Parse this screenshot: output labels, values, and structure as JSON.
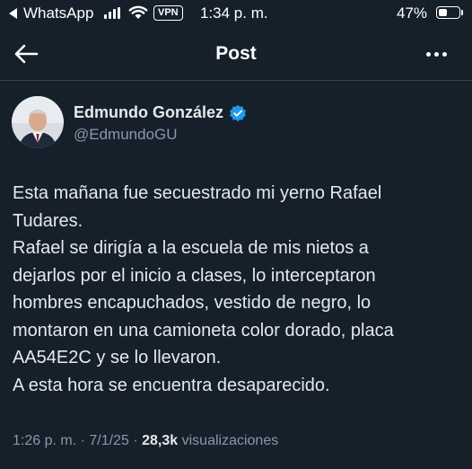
{
  "status_bar": {
    "back_app": "WhatsApp",
    "vpn": "VPN",
    "time": "1:34 p. m.",
    "battery": "47%",
    "battery_level": 0.47
  },
  "header": {
    "title": "Post",
    "back_icon": "arrow-left-icon",
    "more_icon": "ellipsis-horizontal-icon"
  },
  "author": {
    "name": "Edmundo González",
    "handle": "@EdmundoGU",
    "verified_icon": "verified-badge-icon"
  },
  "tweet": {
    "lines": [
      "Esta mañana fue secuestrado mi yerno Rafael",
      "Tudares.",
      "Rafael se dirigía a la escuela de mis nietos a",
      "dejarlos por el inicio a clases, lo interceptaron",
      "hombres encapuchados, vestido de negro, lo",
      "montaron en una camioneta color dorado, placa",
      "AA54E2C y se lo llevaron.",
      "A esta hora se encuentra desaparecido."
    ]
  },
  "meta": {
    "time": "1:26 p. m.",
    "date": "7/1/25",
    "views_count": "28,3k",
    "views_label": "visualizaciones"
  },
  "colors": {
    "background": "#15202b",
    "text": "#e7e9ea",
    "secondary": "#8b98a5",
    "accent": "#1d9bf0"
  }
}
